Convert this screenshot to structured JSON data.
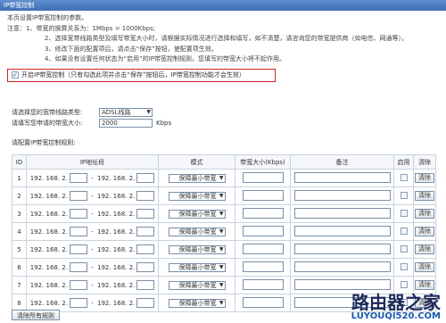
{
  "window": {
    "title": "IP带宽控制"
  },
  "notes": {
    "line0": "本页设置IP带宽控制的参数。",
    "line1": "注意：1、带宽的换算关系为：1Mbps = 1000Kbps;",
    "line2": "2、选择宽带线路类型及填写带宽大小时，请根据实际情况进行选择和填写，如不清楚，请咨询您的带宽提供商（如电信、网通等）。",
    "line3": "3、修改下面的配置项后，请点击“保存”按钮，使配置项生效。",
    "line4": "4、如果没有设置任何状态为“启用”的IP带宽控制规则，您填写的带宽大小将不起作用。"
  },
  "enable": {
    "label": "开启IP带宽控制（只有勾选此项并点击“保存”按钮后，IP带宽控制功能才会生效）",
    "checked": true
  },
  "form": {
    "line_type_label": "请选择您的宽带线路类型:",
    "line_type_value": "ADSL线路",
    "bandwidth_label": "请填写您申请的带宽大小:",
    "bandwidth_value": "2000",
    "bandwidth_unit": "Kbps",
    "rules_label": "请配置IP带宽控制规则:"
  },
  "table": {
    "headers": {
      "id": "ID",
      "ip": "IP地址段",
      "mode": "模式",
      "bw": "带宽大小(Kbps)",
      "note": "备注",
      "enable": "启用",
      "clear": "清除"
    },
    "rows": [
      {
        "id": "1",
        "ip_a": "192. 168. 2.",
        "ip_b": "192. 168. 2.",
        "mode": "保障最小带宽",
        "clear": "清除"
      },
      {
        "id": "2",
        "ip_a": "192. 168. 2.",
        "ip_b": "192. 168. 2.",
        "mode": "保障最小带宽",
        "clear": "清除"
      },
      {
        "id": "3",
        "ip_a": "192. 168. 2.",
        "ip_b": "192. 168. 2.",
        "mode": "保障最小带宽",
        "clear": "清除"
      },
      {
        "id": "4",
        "ip_a": "192. 168. 2.",
        "ip_b": "192. 168. 2.",
        "mode": "保障最小带宽",
        "clear": "清除"
      },
      {
        "id": "5",
        "ip_a": "192. 168. 2.",
        "ip_b": "192. 168. 2.",
        "mode": "保障最小带宽",
        "clear": "清除"
      },
      {
        "id": "6",
        "ip_a": "192. 168. 2.",
        "ip_b": "192. 168. 2.",
        "mode": "保障最小带宽",
        "clear": "清除"
      },
      {
        "id": "7",
        "ip_a": "192. 168. 2.",
        "ip_b": "192. 168. 2.",
        "mode": "保障最小带宽",
        "clear": "清除"
      },
      {
        "id": "8",
        "ip_a": "192. 168. 2.",
        "ip_b": "192. 168. 2.",
        "mode": "保障最小带宽",
        "clear": "清除"
      }
    ]
  },
  "clear_all": "清除所有规则",
  "watermark": {
    "main": "路由器之家",
    "url": "LUYOUQI520.COM"
  }
}
